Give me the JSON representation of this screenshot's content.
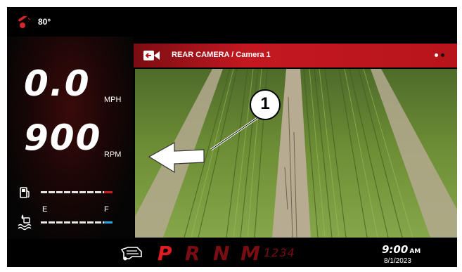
{
  "status": {
    "temperature": "80°",
    "temperature_icon": "thermometer-icon"
  },
  "gauges": {
    "speed_value": "0.0",
    "speed_unit": "MPH",
    "rpm_value": "900",
    "rpm_unit": "RPM",
    "fuel_icon": "fuel-pump-icon",
    "def_icon": "def-fluid-icon",
    "def_empty_label": "E",
    "def_full_label": "F",
    "fuel_end_color": "#c81e1e",
    "def_end_color": "#2aa6e8"
  },
  "camera": {
    "title": "REAR CAMERA / Camera 1",
    "icon": "rear-camera-icon",
    "page_indicator": {
      "count": 2,
      "active": 1
    }
  },
  "callout": {
    "number": "1"
  },
  "transmission": {
    "icon": "transmission-icon",
    "gears": [
      "P",
      "R",
      "N",
      "M"
    ],
    "selected": "P",
    "manual_gears": "1234"
  },
  "clock": {
    "time": "9:00",
    "ampm": "AM",
    "date": "8/1/2023"
  },
  "colors": {
    "accent": "#c41821",
    "active_gear": "#e01b24",
    "inactive_gear": "#7a0d12"
  }
}
